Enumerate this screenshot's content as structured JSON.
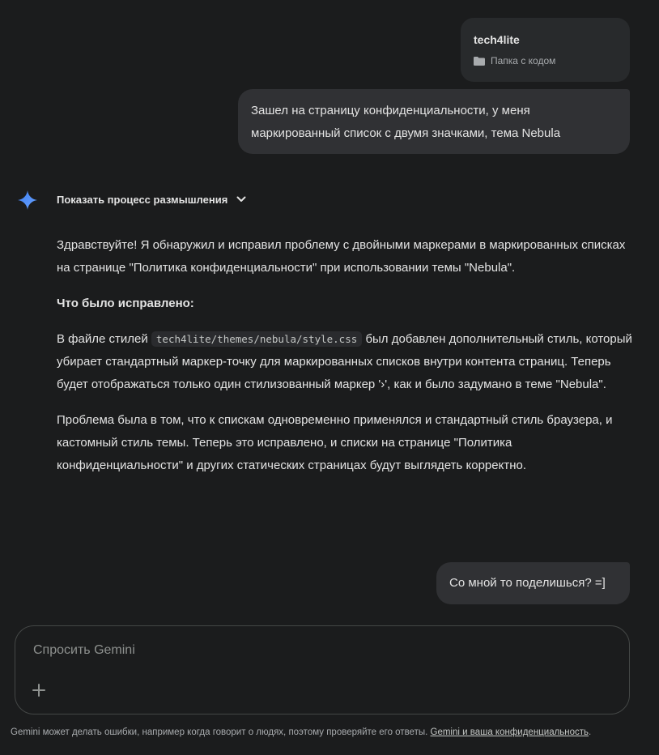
{
  "folder": {
    "name": "tech4lite",
    "subtitle": "Папка с кодом",
    "icon": "folder-icon"
  },
  "messages": {
    "user1": "Зашел на страницу конфиденциальности, у меня маркированный список с двумя значками, тема Nebula",
    "user2": "Со мной то поделишься? =]"
  },
  "thinking": {
    "label": "Показать процесс размышления",
    "icon": "chevron-down-icon"
  },
  "response": {
    "p1": "Здравствуйте! Я обнаружил и исправил проблему с двойными маркерами в маркированных списках на странице \"Политика конфиденциальности\" при использовании темы \"Nebula\".",
    "heading": "Что было исправлено:",
    "p2_before": "В файле стилей",
    "p2_code": "tech4lite/themes/nebula/style.css",
    "p2_after": "был добавлен дополнительный стиль, который убирает стандартный маркер-точку для маркированных списков внутри контента страниц. Теперь будет отображаться только один стилизованный маркер '›', как и было задумано в теме \"Nebula\".",
    "p3": "Проблема была в том, что к спискам одновременно применялся и стандартный стиль браузера, и кастомный стиль темы. Теперь это исправлено, и списки на странице \"Политика конфиденциальности\" и других статических страницах будут выглядеть корректно."
  },
  "input": {
    "placeholder": "Спросить Gemini",
    "value": ""
  },
  "footer": {
    "text": "Gemini может делать ошибки, например когда говорит о людях, поэтому проверяйте его ответы.",
    "link": "Gemini и ваша конфиденциальность",
    "end": "."
  },
  "colors": {
    "background": "#1b1c1d",
    "bubble": "#303134",
    "accent_blue": "#4c8df6"
  }
}
